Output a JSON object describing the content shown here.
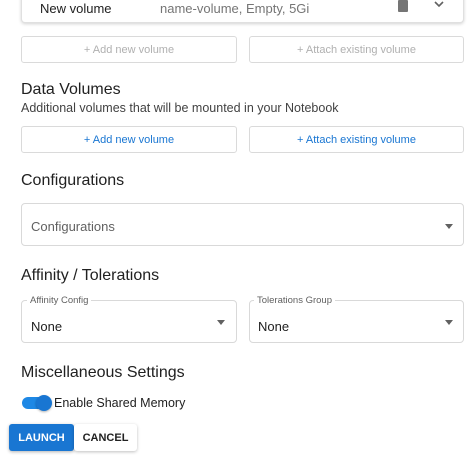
{
  "workspace_volume": {
    "name": "New volume",
    "summary": "name-volume, Empty, 5Gi",
    "add_new_label": "+ Add new volume",
    "attach_existing_label": "+ Attach existing volume"
  },
  "data_volumes": {
    "title": "Data Volumes",
    "subtitle": "Additional volumes that will be mounted in your Notebook",
    "add_new_label": "+ Add new volume",
    "attach_existing_label": "+ Attach existing volume"
  },
  "configurations": {
    "title": "Configurations",
    "placeholder": "Configurations"
  },
  "affinity": {
    "title": "Affinity / Tolerations",
    "affinity_label": "Affinity Config",
    "affinity_value": "None",
    "tolerations_label": "Tolerations Group",
    "tolerations_value": "None"
  },
  "misc": {
    "title": "Miscellaneous Settings",
    "shared_memory_label": "Enable Shared Memory",
    "shared_memory_enabled": true
  },
  "actions": {
    "launch_label": "LAUNCH",
    "cancel_label": "CANCEL"
  },
  "colors": {
    "accent": "#1976d2",
    "disabled_text": "#b0b0b0"
  }
}
